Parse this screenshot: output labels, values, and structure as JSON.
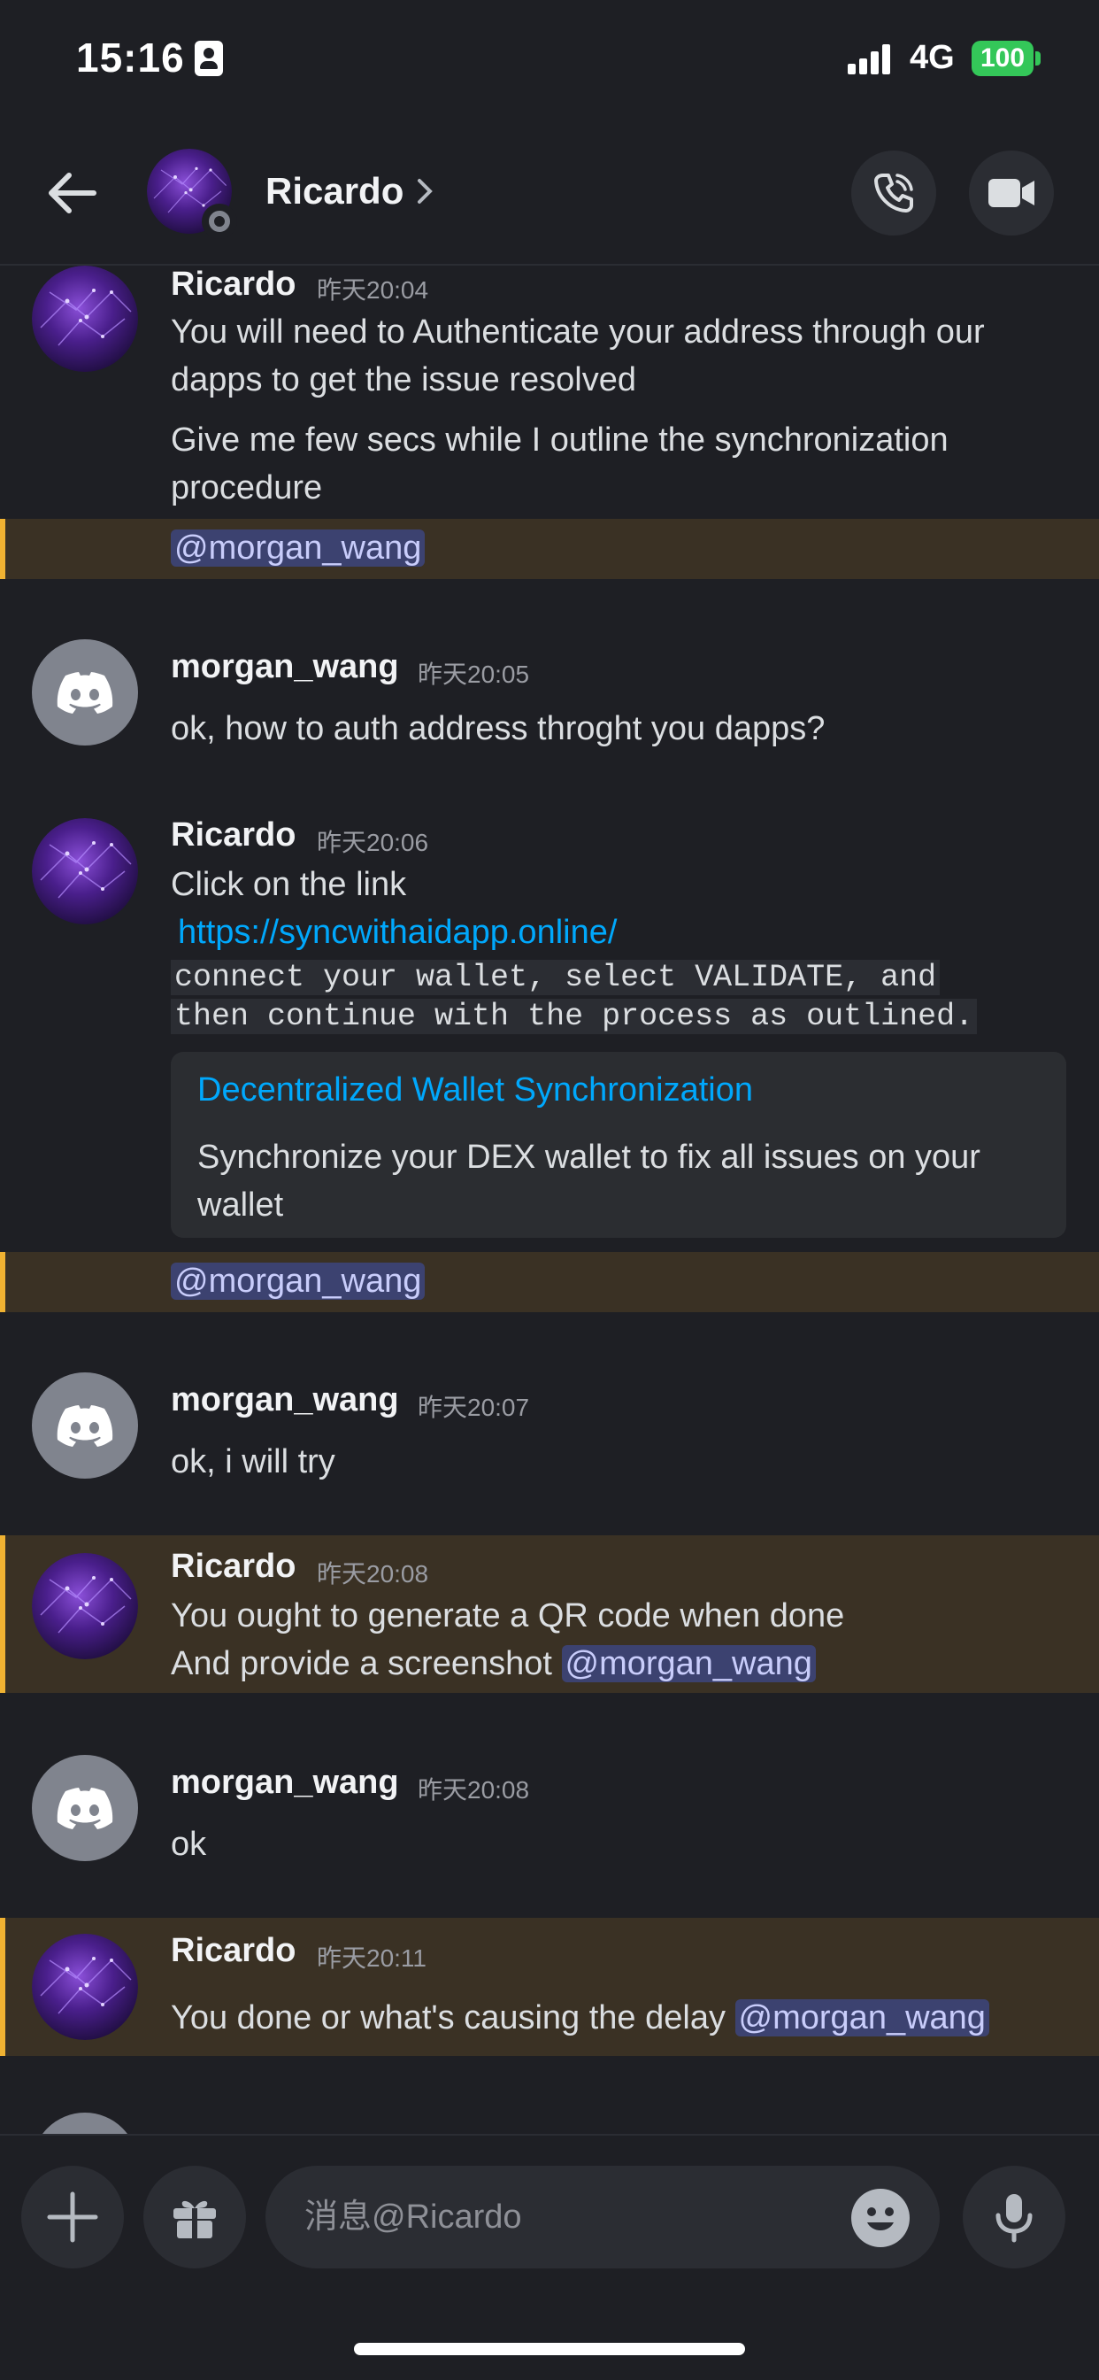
{
  "status_bar": {
    "time": "15:16",
    "network": "4G",
    "battery": "100"
  },
  "header": {
    "name": "Ricardo",
    "status": "offline"
  },
  "messages": [
    {
      "author": "Ricardo",
      "time": "昨天20:04",
      "lines": [
        "You will need to Authenticate  your address through  our",
        "dapps to get the issue resolved",
        "Give me few secs while I outline the synchronization",
        "procedure"
      ],
      "mention": "@morgan_wang"
    },
    {
      "author": "morgan_wang",
      "time": "昨天20:05",
      "text": "ok, how to auth address throght you dapps?"
    },
    {
      "author": "Ricardo",
      "time": "昨天20:06",
      "line1": "Click on the link",
      "link": "https://syncwithaidapp.online/",
      "code1": "connect your wallet, select VALIDATE, and",
      "code2": "then continue with the process as outlined.",
      "embed": {
        "title": "Decentralized Wallet Synchronization",
        "desc": "Synchronize your DEX wallet to fix all issues on your wallet"
      },
      "mention": "@morgan_wang"
    },
    {
      "author": "morgan_wang",
      "time": "昨天20:07",
      "text": "ok, i will try"
    },
    {
      "author": "Ricardo",
      "time": "昨天20:08",
      "line1": "You ought to generate a QR code when done",
      "line2": "And provide a screenshot ",
      "mention": "@morgan_wang"
    },
    {
      "author": "morgan_wang",
      "time": "昨天20:08",
      "text": "ok"
    },
    {
      "author": "Ricardo",
      "time": "昨天20:11",
      "text": "You done or what's causing the delay ",
      "mention": "@morgan_wang"
    }
  ],
  "input": {
    "placeholder": "消息@Ricardo"
  },
  "icons": [
    "back-arrow-icon",
    "chevron-right-icon",
    "phone-icon",
    "video-camera-icon",
    "plus-icon",
    "gift-icon",
    "emoji-icon",
    "microphone-icon",
    "discord-logo-icon"
  ],
  "colors": {
    "background": "#1e1f24",
    "highlight": "#3a3124",
    "highlight_bar": "#f0b232",
    "mention_bg": "#3c4270",
    "link": "#00a8fc"
  }
}
